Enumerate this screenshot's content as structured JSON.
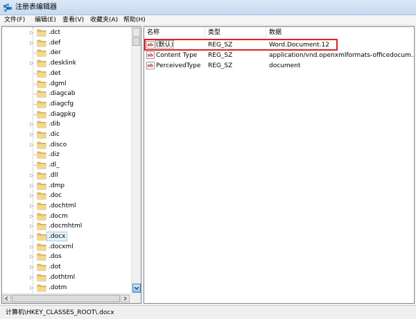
{
  "window": {
    "title": "注册表编辑器"
  },
  "menu": [
    {
      "label": "文件(F)"
    },
    {
      "label": "编辑(E)"
    },
    {
      "label": "查看(V)"
    },
    {
      "label": "收藏夹(A)"
    },
    {
      "label": "帮助(H)"
    }
  ],
  "tree": {
    "items": [
      ".dct",
      ".def",
      ".der",
      ".desklink",
      ".det",
      ".dgml",
      ".diagcab",
      ".diagcfg",
      ".diagpkg",
      ".dib",
      ".dic",
      ".disco",
      ".diz",
      ".dl_",
      ".dll",
      ".dmp",
      ".doc",
      ".dochtml",
      ".docm",
      ".docmhtml",
      ".docx",
      ".docxml",
      ".dos",
      ".dot",
      ".dothtml",
      ".dotm"
    ],
    "expandable": [
      true,
      true,
      false,
      true,
      false,
      false,
      false,
      false,
      false,
      true,
      true,
      true,
      false,
      false,
      true,
      true,
      true,
      true,
      true,
      true,
      true,
      true,
      true,
      true,
      true,
      true
    ],
    "selected_index": 20
  },
  "list": {
    "columns": [
      "名称",
      "类型",
      "数据"
    ],
    "rows": [
      {
        "name": "(默认)",
        "type": "REG_SZ",
        "data": "Word.Document.12"
      },
      {
        "name": "Content Type",
        "type": "REG_SZ",
        "data": "application/vnd.openxmlformats-officedocum..."
      },
      {
        "name": "PerceivedType",
        "type": "REG_SZ",
        "data": "document"
      }
    ]
  },
  "status": {
    "path": "计算机\\HKEY_CLASSES_ROOT\\.docx"
  },
  "colors": {
    "highlight": "#e02020",
    "folder": "#e8c46a",
    "selection": "#e5f3fb"
  }
}
